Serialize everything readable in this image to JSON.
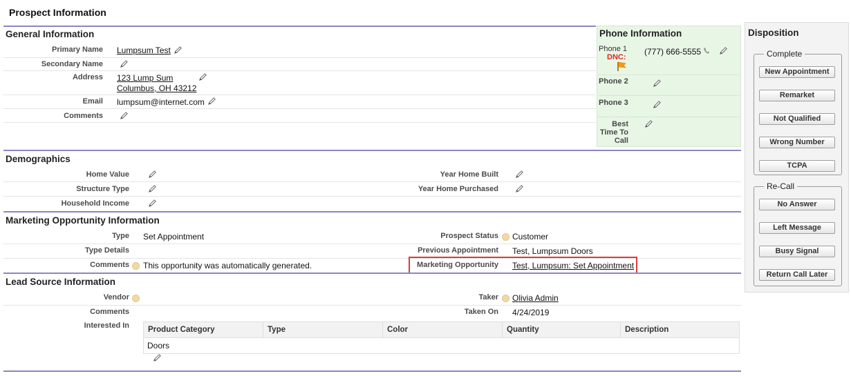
{
  "page_title": "Prospect Information",
  "general": {
    "title": "General Information",
    "primary_name_label": "Primary Name",
    "primary_name": "Lumpsum Test",
    "secondary_name_label": "Secondary Name",
    "address_label": "Address",
    "address_line1": "123 Lump Sum",
    "address_line2": "Columbus, OH 43212",
    "email_label": "Email",
    "email": "lumpsum@internet.com",
    "comments_label": "Comments"
  },
  "phone": {
    "title": "Phone Information",
    "phone1_label": "Phone 1",
    "dnc_label": "DNC:",
    "phone1_value": "(777) 666-5555",
    "phone2_label": "Phone 2",
    "phone3_label": "Phone 3",
    "best_time_label_1": "Best",
    "best_time_label_2": "Time To",
    "best_time_label_3": "Call"
  },
  "disposition": {
    "title": "Disposition",
    "complete_legend": "Complete",
    "complete_buttons": [
      "New Appointment",
      "Remarket",
      "Not Qualified",
      "Wrong Number",
      "TCPA"
    ],
    "recall_legend": "Re-Call",
    "recall_buttons": [
      "No Answer",
      "Left Message",
      "Busy Signal",
      "Return Call Later"
    ]
  },
  "demographics": {
    "title": "Demographics",
    "home_value_label": "Home Value",
    "structure_type_label": "Structure Type",
    "household_income_label": "Household Income",
    "year_built_label": "Year Home Built",
    "year_purchased_label": "Year Home Purchased"
  },
  "marketing": {
    "title": "Marketing Opportunity Information",
    "type_label": "Type",
    "type_value": "Set Appointment",
    "type_details_label": "Type Details",
    "comments_label": "Comments",
    "comments_value": "This opportunity was automatically generated.",
    "prospect_status_label": "Prospect Status",
    "prospect_status_value": "Customer",
    "previous_appt_label": "Previous Appointment",
    "previous_appt_value": "Test, Lumpsum Doors",
    "marketing_opp_label": "Marketing Opportunity",
    "marketing_opp_value": "Test, Lumpsum: Set Appointment"
  },
  "lead": {
    "title": "Lead Source Information",
    "vendor_label": "Vendor",
    "comments_label": "Comments",
    "interested_in_label": "Interested In",
    "taker_label": "Taker",
    "taker_value": "Olivia Admin",
    "taken_on_label": "Taken On",
    "taken_on_value": "4/24/2019",
    "grid_columns": [
      "Product Category",
      "Type",
      "Color",
      "Quantity",
      "Description"
    ],
    "grid_rows": [
      [
        "Doors",
        "",
        "",
        "",
        ""
      ]
    ]
  },
  "colors": {
    "section_rule": "#8d84c6",
    "phone_bg": "#e8f6e6",
    "highlight": "#e03a3a",
    "dnc": "#d62b1e"
  },
  "icons": [
    "pencil-icon",
    "phone-icon",
    "flag-icon",
    "help-icon"
  ]
}
